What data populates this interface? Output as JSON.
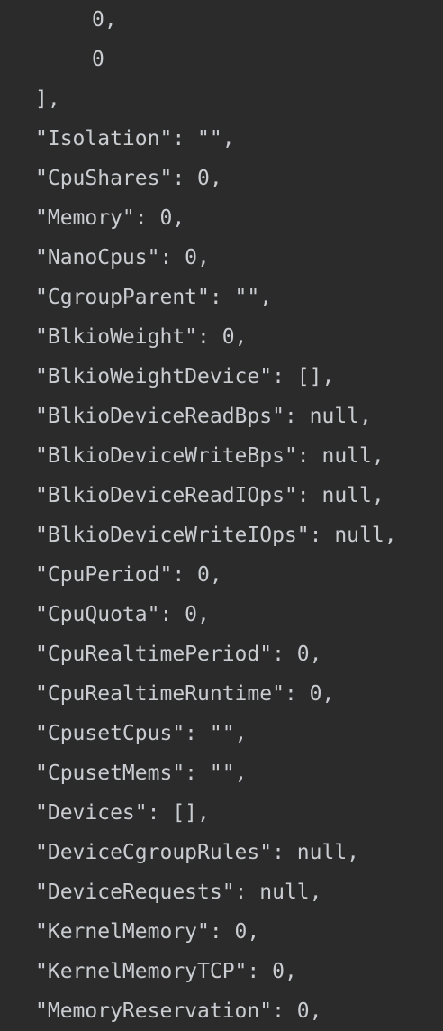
{
  "editor": {
    "lines": [
      {
        "text": "0,",
        "indent": 2
      },
      {
        "text": "0",
        "indent": 2
      },
      {
        "text": "],",
        "indent": 1
      },
      {
        "text": "\"Isolation\": \"\",",
        "indent": 1
      },
      {
        "text": "\"CpuShares\": 0,",
        "indent": 1
      },
      {
        "text": "\"Memory\": 0,",
        "indent": 1
      },
      {
        "text": "\"NanoCpus\": 0,",
        "indent": 1
      },
      {
        "text": "\"CgroupParent\": \"\",",
        "indent": 1
      },
      {
        "text": "\"BlkioWeight\": 0,",
        "indent": 1
      },
      {
        "text": "\"BlkioWeightDevice\": [],",
        "indent": 1
      },
      {
        "text": "\"BlkioDeviceReadBps\": null,",
        "indent": 1
      },
      {
        "text": "\"BlkioDeviceWriteBps\": null,",
        "indent": 1
      },
      {
        "text": "\"BlkioDeviceReadIOps\": null,",
        "indent": 1
      },
      {
        "text": "\"BlkioDeviceWriteIOps\": null,",
        "indent": 1
      },
      {
        "text": "\"CpuPeriod\": 0,",
        "indent": 1
      },
      {
        "text": "\"CpuQuota\": 0,",
        "indent": 1
      },
      {
        "text": "\"CpuRealtimePeriod\": 0,",
        "indent": 1
      },
      {
        "text": "\"CpuRealtimeRuntime\": 0,",
        "indent": 1
      },
      {
        "text": "\"CpusetCpus\": \"\",",
        "indent": 1
      },
      {
        "text": "\"CpusetMems\": \"\",",
        "indent": 1
      },
      {
        "text": "\"Devices\": [],",
        "indent": 1
      },
      {
        "text": "\"DeviceCgroupRules\": null,",
        "indent": 1
      },
      {
        "text": "\"DeviceRequests\": null,",
        "indent": 1
      },
      {
        "text": "\"KernelMemory\": 0,",
        "indent": 1
      },
      {
        "text": "\"KernelMemoryTCP\": 0,",
        "indent": 1
      },
      {
        "text": "\"MemoryReservation\": 0,",
        "indent": 1
      }
    ]
  }
}
